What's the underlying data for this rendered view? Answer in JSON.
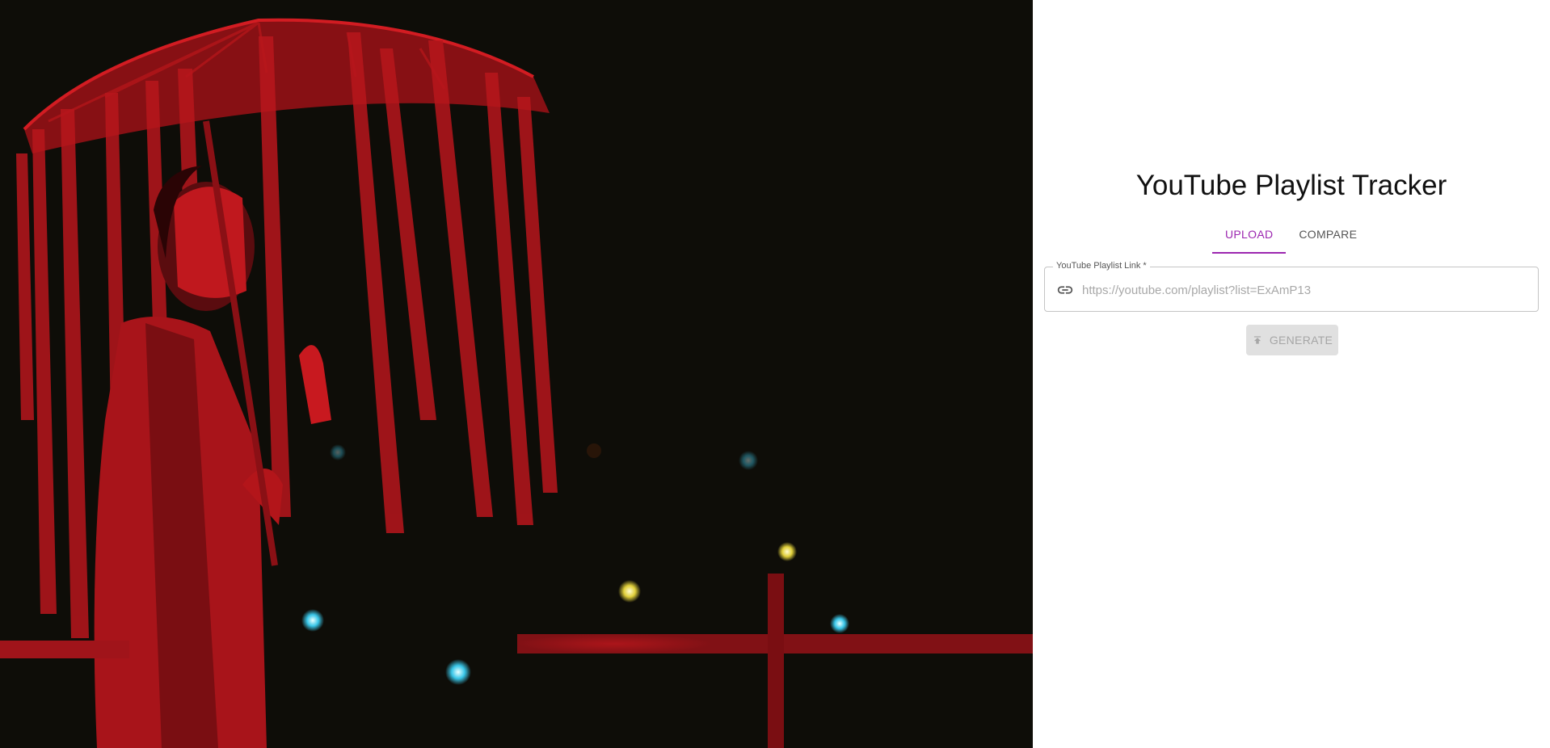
{
  "app": {
    "title": "YouTube Playlist Tracker"
  },
  "tabs": [
    {
      "label": "UPLOAD",
      "active": true
    },
    {
      "label": "COMPARE",
      "active": false
    }
  ],
  "form": {
    "field_label": "YouTube Playlist Link *",
    "placeholder": "https://youtube.com/playlist?list=ExAmP13",
    "value": "",
    "link_icon": "link-icon",
    "generate_label": "GENERATE",
    "generate_icon": "upload-icon",
    "generate_disabled": true
  },
  "colors": {
    "accent": "#9c27b0",
    "disabled_bg": "#e0e0e0",
    "disabled_text": "#a6a6a6",
    "hero_bg": "#0e0d08",
    "hero_red": "#c4161c"
  }
}
